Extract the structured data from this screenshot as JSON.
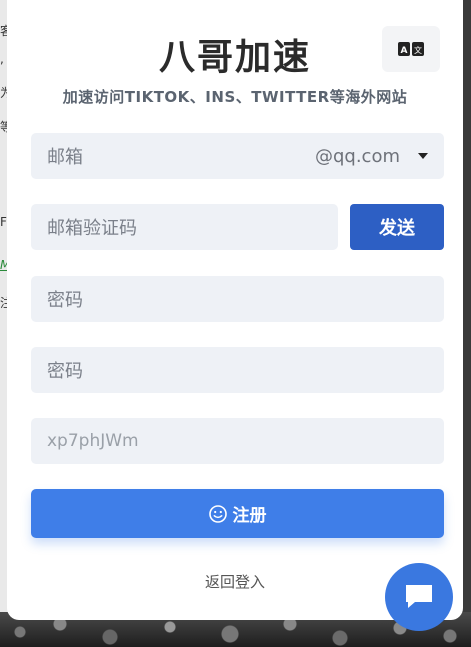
{
  "header": {
    "title": "八哥加速",
    "subtitle": "加速访问TIKTOK、INS、TWITTER等海外网站",
    "language_icon": "translate-icon"
  },
  "form": {
    "email_placeholder": "邮箱",
    "email_domain": "@qq.com",
    "code_placeholder": "邮箱验证码",
    "send_label": "发送",
    "password_placeholder": "密码",
    "confirm_password_placeholder": "密码",
    "captcha_value": "xp7phJWm",
    "register_label": "注册",
    "register_icon": "smile-icon",
    "back_login_label": "返回登入"
  },
  "chat": {
    "icon": "chat-icon"
  },
  "colors": {
    "primary": "#3f7ee8",
    "send_button": "#2d5fc4",
    "field_bg": "#eef1f6",
    "chat_button": "#3a78e0"
  }
}
